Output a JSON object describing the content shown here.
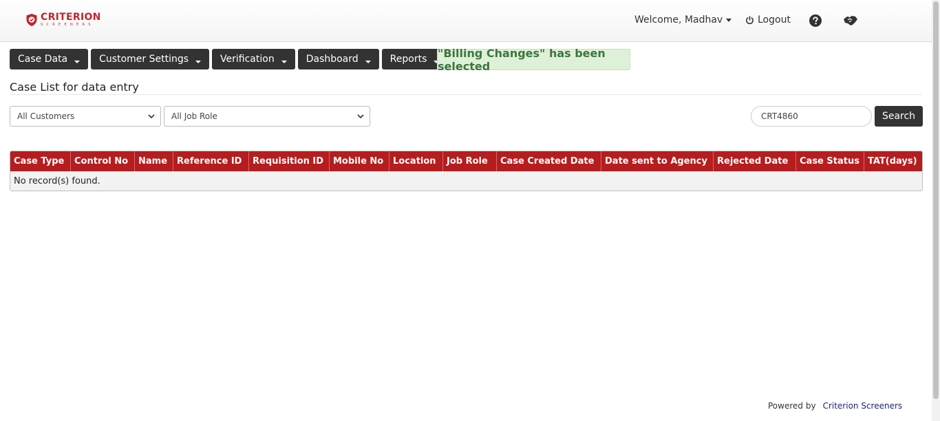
{
  "brand": {
    "name": "CRITERION",
    "tagline": "SCREENERS",
    "color": "#c0272d"
  },
  "header": {
    "welcome": "Welcome, Madhav",
    "logout": "Logout",
    "help_icon": "question-circle-icon",
    "switch_icon": "handshake-icon"
  },
  "menu": [
    {
      "label": "Case Data"
    },
    {
      "label": "Customer Settings"
    },
    {
      "label": "Verification"
    },
    {
      "label": "Dashboard"
    },
    {
      "label": "Reports"
    }
  ],
  "notice": "\"Billing Changes\" has been selected",
  "page_title": "Case List for data entry",
  "filters": {
    "customer": "All Customers",
    "job_role": "All Job Role",
    "search_value": "CRT4860",
    "search_button": "Search"
  },
  "table": {
    "columns": [
      "Case Type",
      "Control No",
      "Name",
      "Reference ID",
      "Requisition ID",
      "Mobile No",
      "Location",
      "Job Role",
      "Case Created Date",
      "Date sent to Agency",
      "Rejected Date",
      "Case Status",
      "TAT(days)"
    ],
    "empty_message": "No record(s) found.",
    "header_color": "#b51d1f"
  },
  "footer": {
    "powered_by": "Powered by",
    "company": "Criterion Screeners"
  }
}
